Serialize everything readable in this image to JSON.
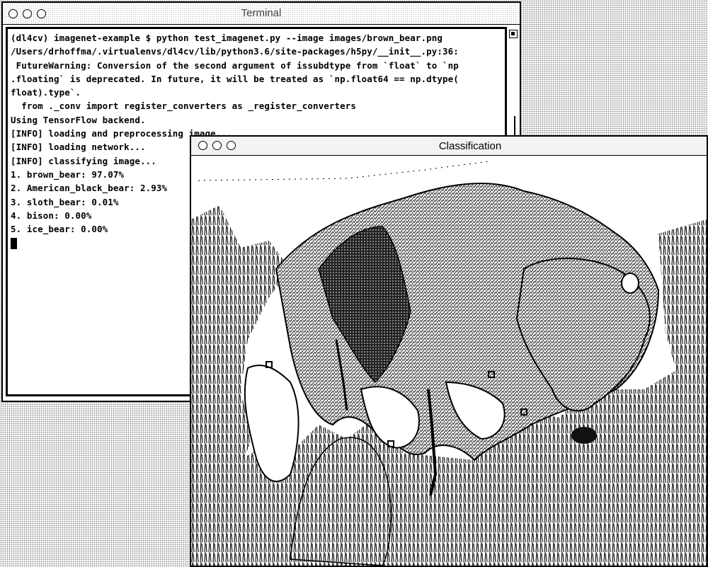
{
  "terminal": {
    "title": "Terminal",
    "lines": [
      "(dl4cv) imagenet-example $ python test_imagenet.py --image images/brown_bear.png",
      "/Users/drhoffma/.virtualenvs/dl4cv/lib/python3.6/site-packages/h5py/__init__.py:36:",
      " FutureWarning: Conversion of the second argument of issubdtype from `float` to `np",
      ".floating` is deprecated. In future, it will be treated as `np.float64 == np.dtype(",
      "float).type`.",
      "  from ._conv import register_converters as _register_converters",
      "Using TensorFlow backend.",
      "[INFO] loading and preprocessing image...",
      "[INFO] loading network...",
      "[INFO] classifying image...",
      "1. brown_bear: 97.07%",
      "2. American_black_bear: 2.93%",
      "3. sloth_bear: 0.01%",
      "4. bison: 0.00%",
      "5. ice_bear: 0.00%"
    ]
  },
  "classification": {
    "title": "Classification",
    "image_subject": "brown bear walking in tall grass"
  },
  "icons": {
    "window_close": "close-light-icon",
    "window_minimize": "minimize-light-icon",
    "window_zoom": "zoom-light-icon"
  },
  "colors": {
    "text": "#000000",
    "background": "#ffffff"
  }
}
